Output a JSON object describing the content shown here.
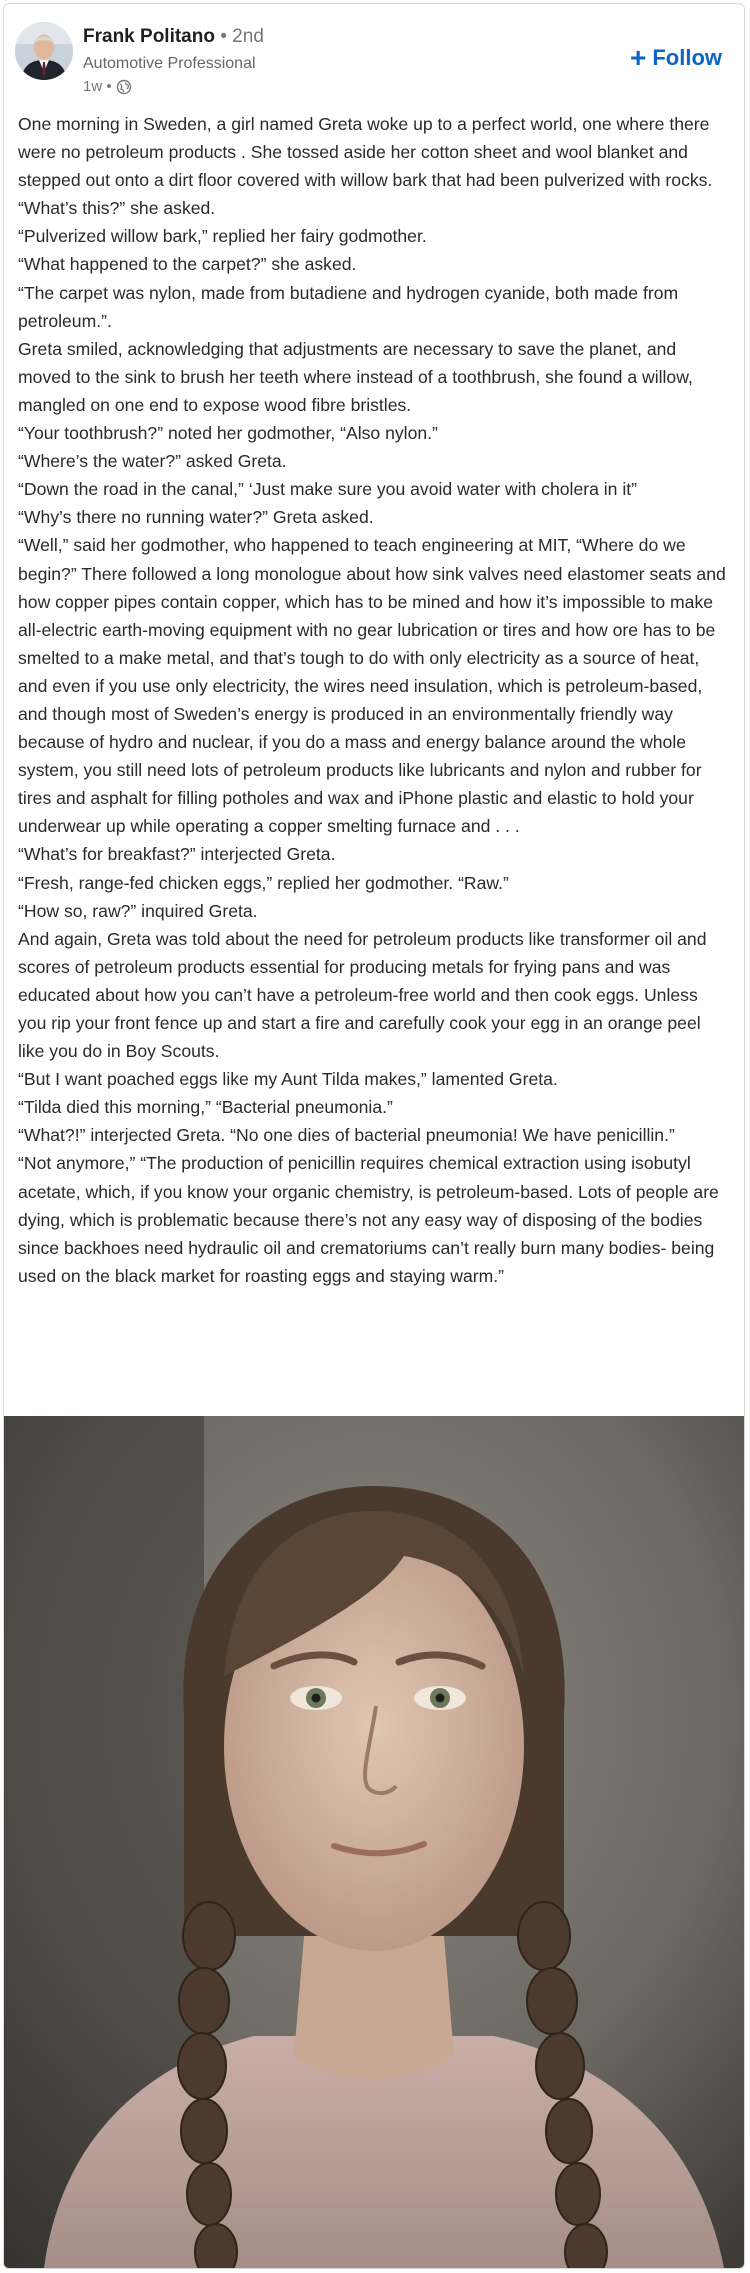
{
  "post": {
    "author": {
      "name": "Frank Politano",
      "degree": "• 2nd",
      "headline": "Automotive Professional",
      "time": "1w •"
    },
    "follow_label": "Follow",
    "paragraphs": [
      "One morning in Sweden, a girl named Greta woke up to a perfect world, one where there were no petroleum products . She tossed aside her cotton sheet and wool blanket and stepped out onto a dirt floor covered with willow bark that had been pulverized with rocks. “What’s this?” she asked.",
      "“Pulverized willow bark,” replied her fairy godmother.",
      "“What happened to the carpet?” she asked.",
      "“The carpet was nylon, made from butadiene and hydrogen cyanide, both made from petroleum.”.",
      "Greta smiled, acknowledging that adjustments are necessary to save the planet, and moved to the sink to brush her teeth where instead of a toothbrush, she found a willow, mangled on one end to expose wood fibre bristles.",
      "“Your toothbrush?” noted her godmother, “Also nylon.”",
      "“Where’s the water?” asked Greta.",
      "“Down the road in the canal,” ‘Just make sure you avoid water with cholera in it”",
      "“Why’s there no running water?” Greta asked.",
      "“Well,” said her godmother, who happened to teach engineering at MIT, “Where do we begin?” There followed a long monologue about how sink valves need elastomer seats and how copper pipes contain copper, which has to be mined and how it’s impossible to make all-electric earth-moving equipment with no gear lubrication or tires and how ore has to be smelted to a make metal, and that’s tough to do with only electricity as a source of heat, and even if you use only electricity, the wires need insulation, which is petroleum-based, and though most of Sweden’s energy is produced in an environmentally friendly way because of hydro and nuclear, if you do a mass and energy balance around the whole system, you still need lots of petroleum products like lubricants and nylon and rubber for tires and asphalt for filling potholes and wax and iPhone plastic and elastic to hold your underwear up while operating a copper smelting furnace and . . .",
      "“What’s for breakfast?” interjected Greta.",
      "“Fresh, range-fed chicken eggs,” replied her godmother. “Raw.”",
      "“How so, raw?” inquired Greta.",
      " And again, Greta was told about the need for petroleum products like transformer oil and scores of petroleum products essential for producing metals for frying pans and was educated about how you can’t have a petroleum-free world and then cook eggs. Unless you rip your front fence up and start a fire and carefully cook your egg in an orange peel like you do in Boy Scouts.",
      "“But I want poached eggs like my Aunt Tilda makes,” lamented Greta.",
      "“Tilda died this morning,” “Bacterial pneumonia.”",
      "“What?!” interjected Greta. “No one dies of bacterial pneumonia! We have penicillin.”",
      "“Not anymore,” “The production of penicillin requires chemical extraction using isobutyl acetate, which, if you know your organic chemistry, is petroleum-based. Lots of people are dying, which is problematic because there’s not any easy way of disposing of the bodies since backhoes need hydraulic oil and crematoriums can’t really burn many bodies- being used on the black market for roasting eggs and staying warm.”"
    ]
  },
  "colors": {
    "link_blue": "#0a66c2",
    "meta_gray": "#777777",
    "text": "#2a2a2a"
  },
  "icons": {
    "follow": "plus-icon",
    "visibility": "globe-icon"
  }
}
